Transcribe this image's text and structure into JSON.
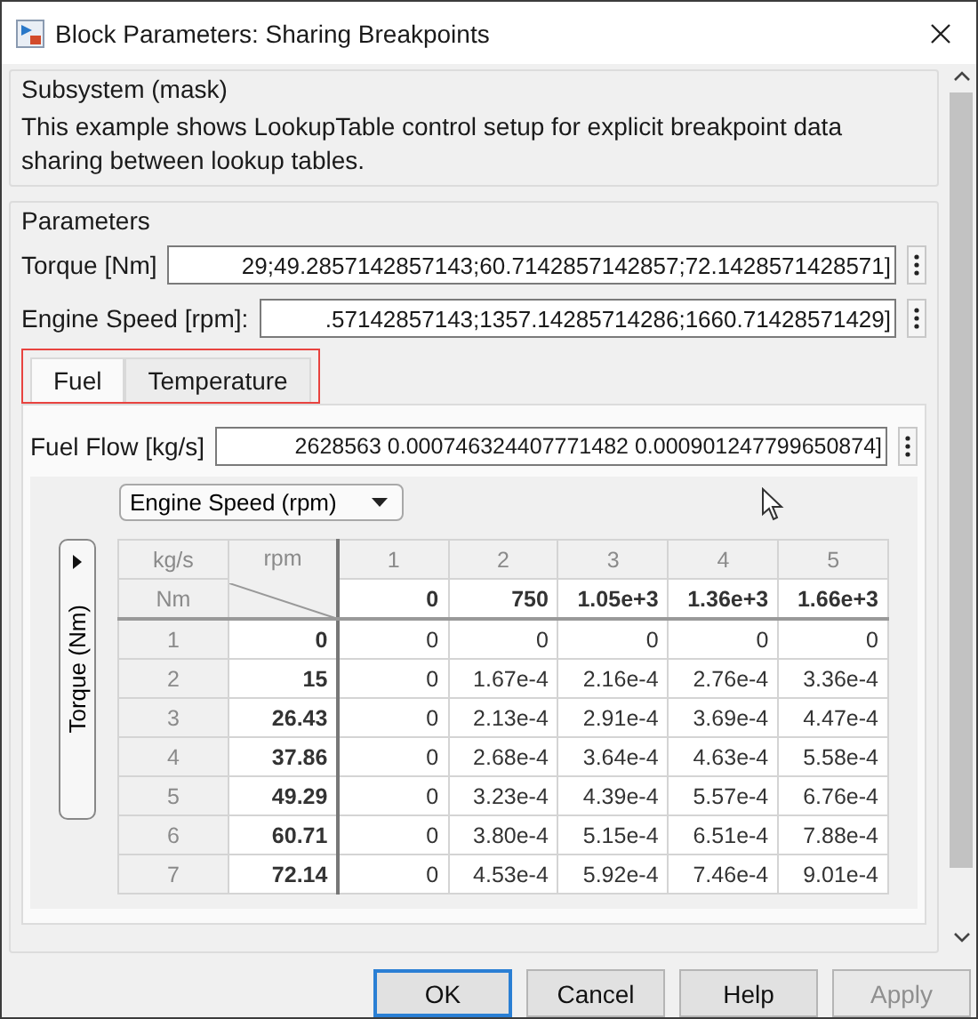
{
  "window": {
    "title": "Block Parameters: Sharing Breakpoints"
  },
  "subsystem": {
    "heading": "Subsystem (mask)",
    "description": "This example shows LookupTable control setup for explicit breakpoint data sharing between lookup tables."
  },
  "parameters": {
    "heading": "Parameters",
    "fields": [
      {
        "label": "Torque [Nm]",
        "value": "29;49.2857142857143;60.7142857142857;72.1428571428571]"
      },
      {
        "label": "Engine Speed [rpm]:",
        "value": ".57142857143;1357.14285714286;1660.71428571429]"
      }
    ]
  },
  "tabs": [
    {
      "label": "Fuel",
      "selected": true
    },
    {
      "label": "Temperature",
      "selected": false
    }
  ],
  "fuel_flow": {
    "label": "Fuel Flow [kg/s]",
    "value": "2628563 0.000746324407771482 0.000901247799650874]"
  },
  "table_view": {
    "dimension_select": "Engine Speed (rpm)",
    "row_axis_button": "Torque (Nm)",
    "corner": {
      "unit": "kg/s",
      "column_unit": "rpm",
      "row_unit": "Nm"
    },
    "column_indices": [
      "1",
      "2",
      "3",
      "4",
      "5"
    ],
    "column_breakpoints": [
      "0",
      "750",
      "1.05e+3",
      "1.36e+3",
      "1.66e+3"
    ],
    "rows": [
      {
        "index": "1",
        "breakpoint": "0",
        "values": [
          "0",
          "0",
          "0",
          "0",
          "0"
        ]
      },
      {
        "index": "2",
        "breakpoint": "15",
        "values": [
          "0",
          "1.67e-4",
          "2.16e-4",
          "2.76e-4",
          "3.36e-4"
        ]
      },
      {
        "index": "3",
        "breakpoint": "26.43",
        "values": [
          "0",
          "2.13e-4",
          "2.91e-4",
          "3.69e-4",
          "4.47e-4"
        ]
      },
      {
        "index": "4",
        "breakpoint": "37.86",
        "values": [
          "0",
          "2.68e-4",
          "3.64e-4",
          "4.63e-4",
          "5.58e-4"
        ]
      },
      {
        "index": "5",
        "breakpoint": "49.29",
        "values": [
          "0",
          "3.23e-4",
          "4.39e-4",
          "5.57e-4",
          "6.76e-4"
        ]
      },
      {
        "index": "6",
        "breakpoint": "60.71",
        "values": [
          "0",
          "3.80e-4",
          "5.15e-4",
          "6.51e-4",
          "7.88e-4"
        ]
      },
      {
        "index": "7",
        "breakpoint": "72.14",
        "values": [
          "0",
          "4.53e-4",
          "5.92e-4",
          "7.46e-4",
          "9.01e-4"
        ]
      }
    ]
  },
  "buttons": [
    {
      "label": "OK",
      "default": true,
      "disabled": false
    },
    {
      "label": "Cancel",
      "default": false,
      "disabled": false
    },
    {
      "label": "Help",
      "default": false,
      "disabled": false
    },
    {
      "label": "Apply",
      "default": false,
      "disabled": true
    }
  ]
}
